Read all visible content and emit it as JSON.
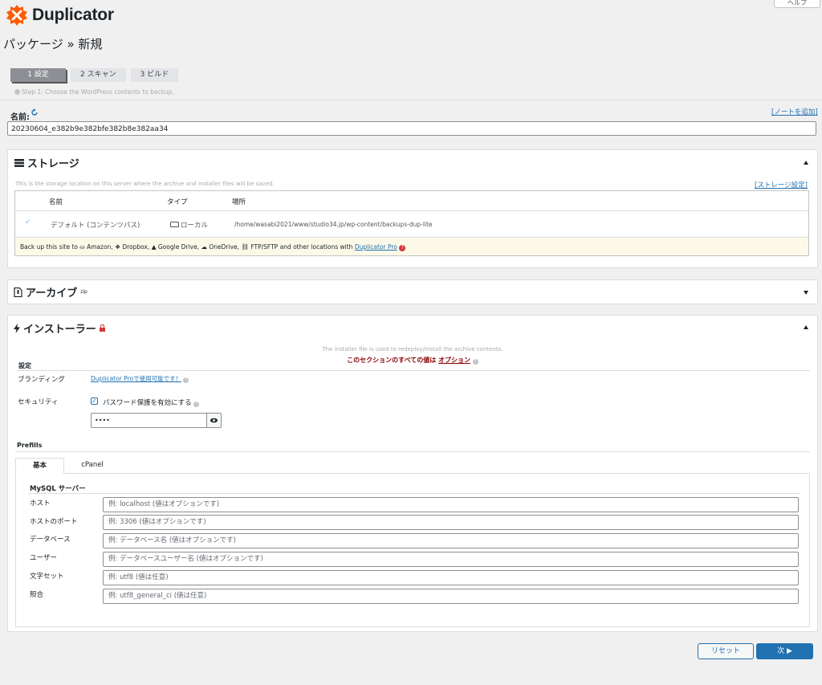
{
  "header": {
    "help_label": "ヘルプ",
    "brand": "Duplicator",
    "page_title": "パッケージ » 新規"
  },
  "steps": [
    {
      "label": "1 設定"
    },
    {
      "label": "2 スキャン"
    },
    {
      "label": "3 ビルド"
    }
  ],
  "step_description": "Step 1: Choose the WordPress contents to backup.",
  "name_section": {
    "label": "名前:",
    "add_note": "[ノートを追加]",
    "value": "20230604_e382b9e382bfe382b8e382aa34"
  },
  "storage": {
    "title": "ストレージ",
    "description": "This is the storage location on this server where the archive and installer files will be saved.",
    "settings_link": "[ストレージ設定]",
    "columns": [
      "名前",
      "タイプ",
      "場所"
    ],
    "row": {
      "name": "デフォルト (コンテンツパス)",
      "type": "ローカル",
      "location": "/home/wasabi2021/www/studio34.jp/wp-content/backups-dup-lite"
    },
    "pro_notice": {
      "prefix": "Back up this site to",
      "amazon": "Amazon,",
      "dropbox": "Dropbox,",
      "gdrive": "Google Drive,",
      "onedrive": "OneDrive,",
      "ftp": "FTP/SFTP and other locations with",
      "link": "Duplicator Pro"
    }
  },
  "archive": {
    "title": "アーカイブ",
    "badge": "zip"
  },
  "installer": {
    "title": "インストーラー",
    "info": "The installer file is used to redeploy/install the archive contents.",
    "optional_notice": "このセクションのすべての値は",
    "optional_link": "オプション",
    "settings_label": "設定",
    "branding_label": "ブランディング",
    "branding_link": "Duplicator Proで使用可能です！",
    "security_label": "セキュリティ",
    "password_checkbox": "パスワード保護を有効にする",
    "password_value": "••••",
    "prefills_label": "Prefills",
    "tabs": [
      "基本",
      "cPanel"
    ],
    "mysql_header": "MySQL サーバー",
    "fields": [
      {
        "label": "ホスト",
        "placeholder": "例: localhost (値はオプションです)"
      },
      {
        "label": "ホストのポート",
        "placeholder": "例: 3306 (値はオプションです)"
      },
      {
        "label": "データベース",
        "placeholder": "例: データベース名 (値はオプションです)"
      },
      {
        "label": "ユーザー",
        "placeholder": "例: データベースユーザー名 (値はオプションです)"
      },
      {
        "label": "文字セット",
        "placeholder": "例: utf8 (値は任意)"
      },
      {
        "label": "照合",
        "placeholder": "例: utf8_general_ci (値は任意)"
      }
    ]
  },
  "actions": {
    "reset": "リセット",
    "next": "次 ▶"
  },
  "colors": {
    "link": "#2271b1",
    "primary_button": "#2271b1",
    "notice_red": "#8b0000",
    "brand_orange": "#ff5a00"
  }
}
